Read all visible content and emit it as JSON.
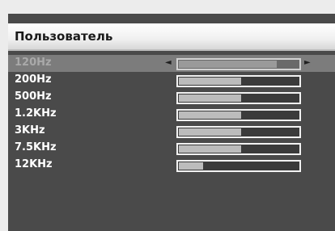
{
  "menu": {
    "title": "Пользователь"
  },
  "equalizer": {
    "bands": [
      {
        "label": "120Hz",
        "level": 0.82,
        "selected": true
      },
      {
        "label": "200Hz",
        "level": 0.52,
        "selected": false
      },
      {
        "label": "500Hz",
        "level": 0.52,
        "selected": false
      },
      {
        "label": "1.2KHz",
        "level": 0.52,
        "selected": false
      },
      {
        "label": "3KHz",
        "level": 0.52,
        "selected": false
      },
      {
        "label": "7.5KHz",
        "level": 0.52,
        "selected": false
      },
      {
        "label": "12KHz",
        "level": 0.2,
        "selected": false
      }
    ]
  },
  "icons": {
    "left": "◄",
    "right": "►"
  },
  "colors": {
    "panel_background": "#4a4a4a",
    "selected_row": "#7c7c7c",
    "bar_fill": "#bcbcbc",
    "title_bar": "#f0f0f0"
  }
}
